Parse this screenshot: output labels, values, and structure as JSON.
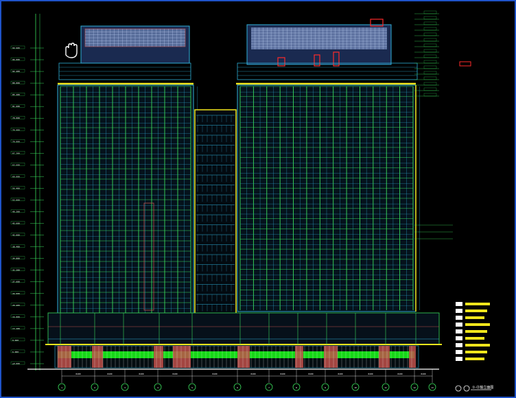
{
  "drawing": {
    "type": "architectural-elevation",
    "title": "①-⑬轴立面图",
    "colors": {
      "background": "#000000",
      "frame": "#1e52c8",
      "facade": "#2fb0d8",
      "grid": "#3adc5c",
      "accent_yellow": "#f2e61c",
      "accent_red": "#ff2a2a",
      "podium_green": "#18f018",
      "stone": "#c0504a",
      "roof_panel": "#8aa2d6",
      "dim_white": "#ffffff"
    },
    "pan_cursor_icon": "hand-pan-icon",
    "axis_bubbles": [
      "1",
      "2",
      "3",
      "4",
      "5",
      "6",
      "7",
      "8",
      "9",
      "10",
      "11",
      "12",
      "13"
    ],
    "dimension_labels": [
      "8400",
      "8400",
      "8400",
      "8400",
      "8400",
      "8400",
      "8400",
      "8400",
      "8400",
      "8400",
      "8400",
      "8400"
    ],
    "level_labels": [
      "99.900",
      "96.000",
      "92.400",
      "88.800",
      "85.200",
      "81.600",
      "78.000",
      "74.400",
      "70.800",
      "67.200",
      "63.600",
      "60.000",
      "56.400",
      "52.800",
      "49.200",
      "45.600",
      "42.000",
      "38.400",
      "34.800",
      "31.200",
      "27.600",
      "24.000",
      "20.400",
      "16.800",
      "13.200",
      "9.600",
      "6.000",
      "±0.000"
    ],
    "legend_items": [
      "",
      "",
      "",
      "",
      "",
      "",
      "",
      "",
      ""
    ]
  }
}
